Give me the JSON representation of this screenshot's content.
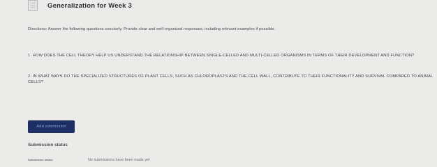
{
  "header": {
    "title": "Generalization for Week 3",
    "icon": "assignment-icon"
  },
  "directions": "Directions: Answer the following questions concisely. Provide clear and well-organized responses, including relevant examples if possible.",
  "questions": [
    "1. HOW DOES THE CELL THEORY HELP US UNDERSTAND THE RELATIONSHIP BETWEEN SINGLE-CELLED AND MULTI-CELLED ORGANISMS IN TERMS OF THEIR DEVELOPMENT AND FUNCTION?",
    "2. IN WHAT WAYS DO THE SPECIALIZED STRUCTURES OF PLANT CELLS, SUCH AS CHLOROPLASTS AND THE CELL WALL, CONTRIBUTE TO THEIR FUNCTIONALITY AND SURVIVAL COMPARED TO ANIMAL CELLS?"
  ],
  "actions": {
    "add_submission_label": "Add submission"
  },
  "submission_status": {
    "heading": "Submission status",
    "label": "Submission status",
    "value": "No submissions have been made yet"
  },
  "colors": {
    "background": "#ebebea",
    "button": "#1e2f66"
  }
}
